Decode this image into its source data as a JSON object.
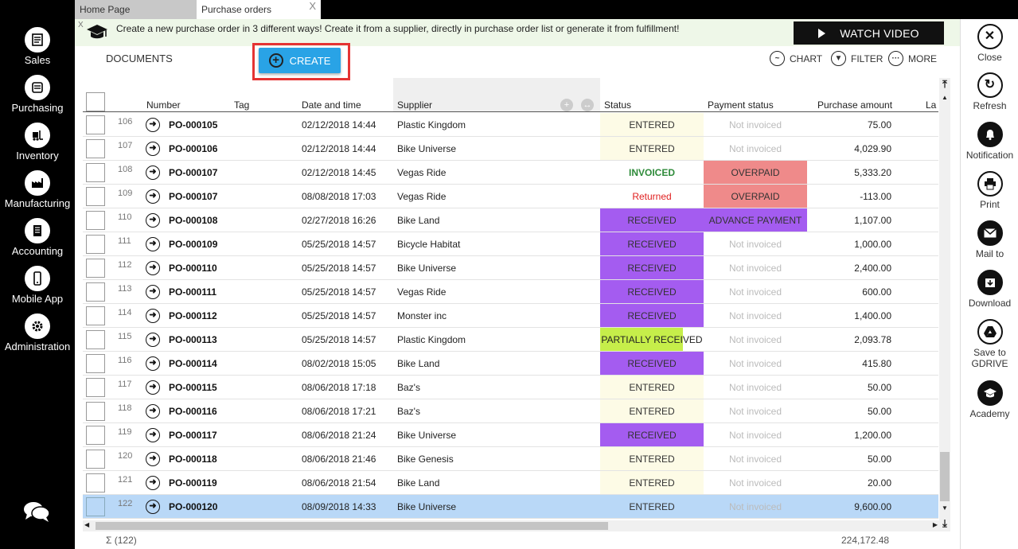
{
  "tabs": [
    {
      "label": "Home Page"
    },
    {
      "label": "Purchase orders",
      "close": "X"
    }
  ],
  "left_nav": [
    {
      "label": "Sales",
      "icon": "sales-icon"
    },
    {
      "label": "Purchasing",
      "icon": "purchasing-icon"
    },
    {
      "label": "Inventory",
      "icon": "forklift-icon"
    },
    {
      "label": "Manufacturing",
      "icon": "factory-icon"
    },
    {
      "label": "Accounting",
      "icon": "ledger-icon"
    },
    {
      "label": "Mobile App",
      "icon": "phone-icon"
    },
    {
      "label": "Administration",
      "icon": "gear-icon"
    }
  ],
  "right_bar": [
    {
      "label": "Close",
      "icon": "close-icon"
    },
    {
      "label": "Refresh",
      "icon": "refresh-icon"
    },
    {
      "label": "Notification",
      "icon": "bell-icon"
    },
    {
      "label": "Print",
      "icon": "printer-icon"
    },
    {
      "label": "Mail to",
      "icon": "mail-icon"
    },
    {
      "label": "Download",
      "icon": "download-icon"
    },
    {
      "label": "Save to",
      "label2": "GDRIVE",
      "icon": "gdrive-icon"
    },
    {
      "label": "Academy",
      "icon": "graduation-cap-icon"
    }
  ],
  "banner": {
    "close": "X",
    "message": "Create a new purchase order in 3 different ways! Create it from a supplier, directly in purchase order list or generate it from fulfillment!",
    "watch_label": "WATCH VIDEO"
  },
  "toolbar": {
    "documents": "DOCUMENTS",
    "create": "CREATE",
    "chart": "CHART",
    "filter": "FILTER",
    "more": "MORE"
  },
  "columns": {
    "number": "Number",
    "tag": "Tag",
    "date": "Date and time",
    "supplier": "Supplier",
    "status": "Status",
    "payment": "Payment status",
    "amount": "Purchase amount",
    "last": "La"
  },
  "colors": {
    "entered_bg": "#fdfbe6",
    "invoiced": "#2e8b3a",
    "returned": "#e02020",
    "overpaid_bg": "#ef8a8a",
    "received_bg": "#a45cf0",
    "advance_bg": "#a45cf0",
    "partial_bg": "#c6ee4a",
    "not_invoiced": "#bbbbbb",
    "selected_row": "#b9d8f7"
  },
  "rows": [
    {
      "idx": "106",
      "number": "PO-000105",
      "date": "02/12/2018 14:44",
      "supplier": "Plastic Kingdom",
      "status": "ENTERED",
      "payment": "Not invoiced",
      "amount": "75.00"
    },
    {
      "idx": "107",
      "number": "PO-000106",
      "date": "02/12/2018 14:44",
      "supplier": "Bike Universe",
      "status": "ENTERED",
      "payment": "Not invoiced",
      "amount": "4,029.90"
    },
    {
      "idx": "108",
      "number": "PO-000107",
      "date": "02/12/2018 14:45",
      "supplier": "Vegas Ride",
      "status": "INVOICED",
      "payment": "OVERPAID",
      "amount": "5,333.20"
    },
    {
      "idx": "109",
      "number": "PO-000107",
      "date": "08/08/2018 17:03",
      "supplier": "Vegas Ride",
      "status": "Returned",
      "payment": "OVERPAID",
      "amount": "-113.00"
    },
    {
      "idx": "110",
      "number": "PO-000108",
      "date": "02/27/2018 16:26",
      "supplier": "Bike Land",
      "status": "RECEIVED",
      "payment": "ADVANCE PAYMENT",
      "amount": "1,107.00"
    },
    {
      "idx": "111",
      "number": "PO-000109",
      "date": "05/25/2018 14:57",
      "supplier": "Bicycle Habitat",
      "status": "RECEIVED",
      "payment": "Not invoiced",
      "amount": "1,000.00"
    },
    {
      "idx": "112",
      "number": "PO-000110",
      "date": "05/25/2018 14:57",
      "supplier": "Bike Universe",
      "status": "RECEIVED",
      "payment": "Not invoiced",
      "amount": "2,400.00"
    },
    {
      "idx": "113",
      "number": "PO-000111",
      "date": "05/25/2018 14:57",
      "supplier": "Vegas Ride",
      "status": "RECEIVED",
      "payment": "Not invoiced",
      "amount": "600.00"
    },
    {
      "idx": "114",
      "number": "PO-000112",
      "date": "05/25/2018 14:57",
      "supplier": "Monster inc",
      "status": "RECEIVED",
      "payment": "Not invoiced",
      "amount": "1,400.00"
    },
    {
      "idx": "115",
      "number": "PO-000113",
      "date": "05/25/2018 14:57",
      "supplier": "Plastic Kingdom",
      "status": "PARTIALLY RECEIVED",
      "payment": "Not invoiced",
      "amount": "2,093.78"
    },
    {
      "idx": "116",
      "number": "PO-000114",
      "date": "08/02/2018 15:05",
      "supplier": "Bike Land",
      "status": "RECEIVED",
      "payment": "Not invoiced",
      "amount": "415.80"
    },
    {
      "idx": "117",
      "number": "PO-000115",
      "date": "08/06/2018 17:18",
      "supplier": "Baz's",
      "status": "ENTERED",
      "payment": "Not invoiced",
      "amount": "50.00"
    },
    {
      "idx": "118",
      "number": "PO-000116",
      "date": "08/06/2018 17:21",
      "supplier": "Baz's",
      "status": "ENTERED",
      "payment": "Not invoiced",
      "amount": "50.00"
    },
    {
      "idx": "119",
      "number": "PO-000117",
      "date": "08/06/2018 21:24",
      "supplier": "Bike Universe",
      "status": "RECEIVED",
      "payment": "Not invoiced",
      "amount": "1,200.00"
    },
    {
      "idx": "120",
      "number": "PO-000118",
      "date": "08/06/2018 21:46",
      "supplier": "Bike Genesis",
      "status": "ENTERED",
      "payment": "Not invoiced",
      "amount": "50.00"
    },
    {
      "idx": "121",
      "number": "PO-000119",
      "date": "08/06/2018 21:54",
      "supplier": "Bike Land",
      "status": "ENTERED",
      "payment": "Not invoiced",
      "amount": "20.00"
    },
    {
      "idx": "122",
      "number": "PO-000120",
      "date": "08/09/2018 14:33",
      "supplier": "Bike Universe",
      "status": "ENTERED",
      "payment": "Not invoiced",
      "amount": "9,600.00",
      "selected": true
    }
  ],
  "footer": {
    "count": "Σ (122)",
    "total": "224,172.48"
  }
}
